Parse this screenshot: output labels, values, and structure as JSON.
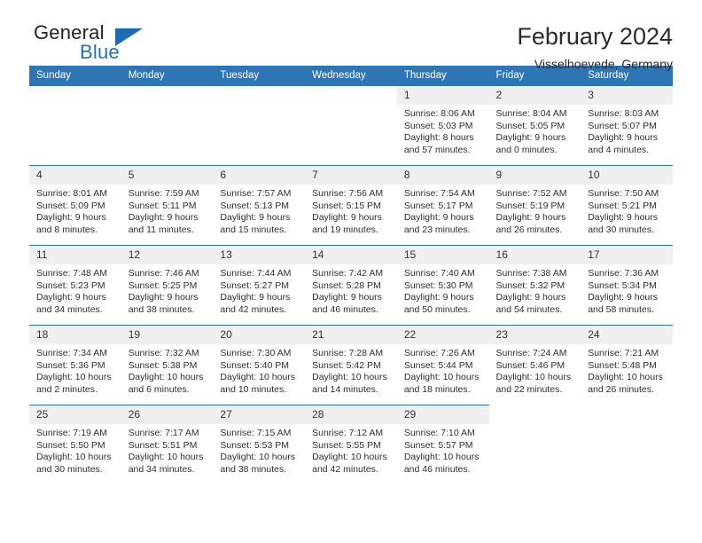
{
  "logo": {
    "word_top": "General",
    "word_bottom": "Blue",
    "triangle_color": "#1b6cb4",
    "blue_color": "#1f72bb"
  },
  "header": {
    "title": "February 2024",
    "subtitle": "Visselhoevede, Germany"
  },
  "theme": {
    "header_bg": "#2e75b6",
    "daynum_bg": "#efefef",
    "divider": "#2e75b6"
  },
  "weekdays": [
    "Sunday",
    "Monday",
    "Tuesday",
    "Wednesday",
    "Thursday",
    "Friday",
    "Saturday"
  ],
  "weeks": [
    [
      {
        "empty": true
      },
      {
        "empty": true
      },
      {
        "empty": true
      },
      {
        "empty": true
      },
      {
        "day": "1",
        "sunrise": "Sunrise: 8:06 AM",
        "sunset": "Sunset: 5:03 PM",
        "daylight1": "Daylight: 8 hours",
        "daylight2": "and 57 minutes."
      },
      {
        "day": "2",
        "sunrise": "Sunrise: 8:04 AM",
        "sunset": "Sunset: 5:05 PM",
        "daylight1": "Daylight: 9 hours",
        "daylight2": "and 0 minutes."
      },
      {
        "day": "3",
        "sunrise": "Sunrise: 8:03 AM",
        "sunset": "Sunset: 5:07 PM",
        "daylight1": "Daylight: 9 hours",
        "daylight2": "and 4 minutes."
      }
    ],
    [
      {
        "day": "4",
        "sunrise": "Sunrise: 8:01 AM",
        "sunset": "Sunset: 5:09 PM",
        "daylight1": "Daylight: 9 hours",
        "daylight2": "and 8 minutes."
      },
      {
        "day": "5",
        "sunrise": "Sunrise: 7:59 AM",
        "sunset": "Sunset: 5:11 PM",
        "daylight1": "Daylight: 9 hours",
        "daylight2": "and 11 minutes."
      },
      {
        "day": "6",
        "sunrise": "Sunrise: 7:57 AM",
        "sunset": "Sunset: 5:13 PM",
        "daylight1": "Daylight: 9 hours",
        "daylight2": "and 15 minutes."
      },
      {
        "day": "7",
        "sunrise": "Sunrise: 7:56 AM",
        "sunset": "Sunset: 5:15 PM",
        "daylight1": "Daylight: 9 hours",
        "daylight2": "and 19 minutes."
      },
      {
        "day": "8",
        "sunrise": "Sunrise: 7:54 AM",
        "sunset": "Sunset: 5:17 PM",
        "daylight1": "Daylight: 9 hours",
        "daylight2": "and 23 minutes."
      },
      {
        "day": "9",
        "sunrise": "Sunrise: 7:52 AM",
        "sunset": "Sunset: 5:19 PM",
        "daylight1": "Daylight: 9 hours",
        "daylight2": "and 26 minutes."
      },
      {
        "day": "10",
        "sunrise": "Sunrise: 7:50 AM",
        "sunset": "Sunset: 5:21 PM",
        "daylight1": "Daylight: 9 hours",
        "daylight2": "and 30 minutes."
      }
    ],
    [
      {
        "day": "11",
        "sunrise": "Sunrise: 7:48 AM",
        "sunset": "Sunset: 5:23 PM",
        "daylight1": "Daylight: 9 hours",
        "daylight2": "and 34 minutes."
      },
      {
        "day": "12",
        "sunrise": "Sunrise: 7:46 AM",
        "sunset": "Sunset: 5:25 PM",
        "daylight1": "Daylight: 9 hours",
        "daylight2": "and 38 minutes."
      },
      {
        "day": "13",
        "sunrise": "Sunrise: 7:44 AM",
        "sunset": "Sunset: 5:27 PM",
        "daylight1": "Daylight: 9 hours",
        "daylight2": "and 42 minutes."
      },
      {
        "day": "14",
        "sunrise": "Sunrise: 7:42 AM",
        "sunset": "Sunset: 5:28 PM",
        "daylight1": "Daylight: 9 hours",
        "daylight2": "and 46 minutes."
      },
      {
        "day": "15",
        "sunrise": "Sunrise: 7:40 AM",
        "sunset": "Sunset: 5:30 PM",
        "daylight1": "Daylight: 9 hours",
        "daylight2": "and 50 minutes."
      },
      {
        "day": "16",
        "sunrise": "Sunrise: 7:38 AM",
        "sunset": "Sunset: 5:32 PM",
        "daylight1": "Daylight: 9 hours",
        "daylight2": "and 54 minutes."
      },
      {
        "day": "17",
        "sunrise": "Sunrise: 7:36 AM",
        "sunset": "Sunset: 5:34 PM",
        "daylight1": "Daylight: 9 hours",
        "daylight2": "and 58 minutes."
      }
    ],
    [
      {
        "day": "18",
        "sunrise": "Sunrise: 7:34 AM",
        "sunset": "Sunset: 5:36 PM",
        "daylight1": "Daylight: 10 hours",
        "daylight2": "and 2 minutes."
      },
      {
        "day": "19",
        "sunrise": "Sunrise: 7:32 AM",
        "sunset": "Sunset: 5:38 PM",
        "daylight1": "Daylight: 10 hours",
        "daylight2": "and 6 minutes."
      },
      {
        "day": "20",
        "sunrise": "Sunrise: 7:30 AM",
        "sunset": "Sunset: 5:40 PM",
        "daylight1": "Daylight: 10 hours",
        "daylight2": "and 10 minutes."
      },
      {
        "day": "21",
        "sunrise": "Sunrise: 7:28 AM",
        "sunset": "Sunset: 5:42 PM",
        "daylight1": "Daylight: 10 hours",
        "daylight2": "and 14 minutes."
      },
      {
        "day": "22",
        "sunrise": "Sunrise: 7:26 AM",
        "sunset": "Sunset: 5:44 PM",
        "daylight1": "Daylight: 10 hours",
        "daylight2": "and 18 minutes."
      },
      {
        "day": "23",
        "sunrise": "Sunrise: 7:24 AM",
        "sunset": "Sunset: 5:46 PM",
        "daylight1": "Daylight: 10 hours",
        "daylight2": "and 22 minutes."
      },
      {
        "day": "24",
        "sunrise": "Sunrise: 7:21 AM",
        "sunset": "Sunset: 5:48 PM",
        "daylight1": "Daylight: 10 hours",
        "daylight2": "and 26 minutes."
      }
    ],
    [
      {
        "day": "25",
        "sunrise": "Sunrise: 7:19 AM",
        "sunset": "Sunset: 5:50 PM",
        "daylight1": "Daylight: 10 hours",
        "daylight2": "and 30 minutes."
      },
      {
        "day": "26",
        "sunrise": "Sunrise: 7:17 AM",
        "sunset": "Sunset: 5:51 PM",
        "daylight1": "Daylight: 10 hours",
        "daylight2": "and 34 minutes."
      },
      {
        "day": "27",
        "sunrise": "Sunrise: 7:15 AM",
        "sunset": "Sunset: 5:53 PM",
        "daylight1": "Daylight: 10 hours",
        "daylight2": "and 38 minutes."
      },
      {
        "day": "28",
        "sunrise": "Sunrise: 7:12 AM",
        "sunset": "Sunset: 5:55 PM",
        "daylight1": "Daylight: 10 hours",
        "daylight2": "and 42 minutes."
      },
      {
        "day": "29",
        "sunrise": "Sunrise: 7:10 AM",
        "sunset": "Sunset: 5:57 PM",
        "daylight1": "Daylight: 10 hours",
        "daylight2": "and 46 minutes."
      },
      {
        "empty": true
      },
      {
        "empty": true
      }
    ]
  ]
}
